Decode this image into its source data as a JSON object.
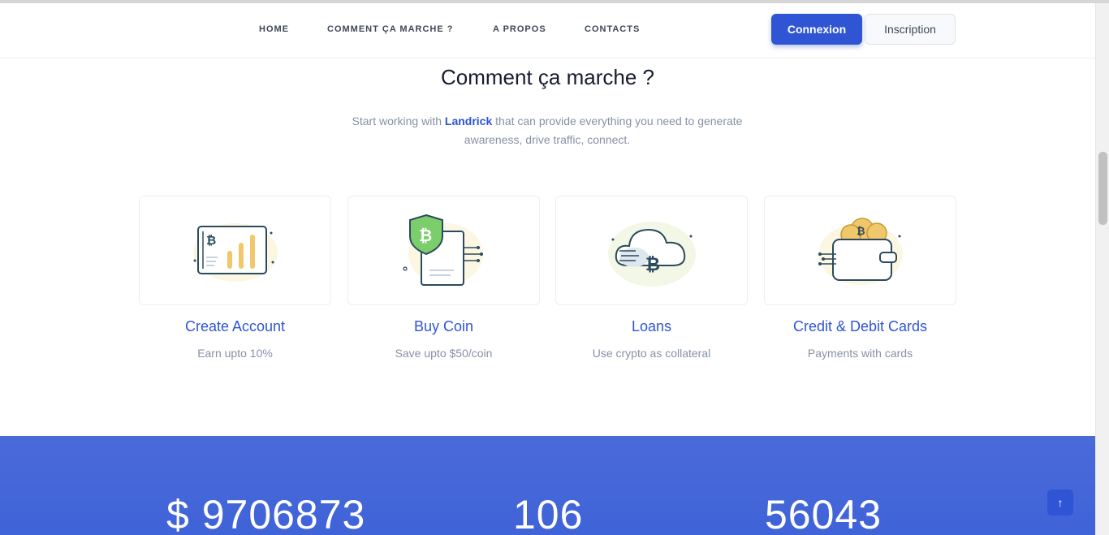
{
  "nav": {
    "items": [
      {
        "label": "HOME"
      },
      {
        "label": "COMMENT ÇA MARCHE ?"
      },
      {
        "label": "A PROPOS"
      },
      {
        "label": "CONTACTS"
      }
    ],
    "login_label": "Connexion",
    "signup_label": "Inscription"
  },
  "section": {
    "title": "Comment ça marche ?",
    "lead_prefix": "Start working with ",
    "lead_brand": "Landrick",
    "lead_suffix": " that can provide everything you need to generate awareness, drive traffic, connect."
  },
  "features": [
    {
      "title": "Create Account",
      "desc": "Earn upto 10%",
      "icon": "bitcoin-chart-icon"
    },
    {
      "title": "Buy Coin",
      "desc": "Save upto $50/coin",
      "icon": "bitcoin-shield-icon"
    },
    {
      "title": "Loans",
      "desc": "Use crypto as collateral",
      "icon": "bitcoin-cloud-icon"
    },
    {
      "title": "Credit & Debit Cards",
      "desc": "Payments with cards",
      "icon": "bitcoin-wallet-icon"
    }
  ],
  "stats": [
    {
      "value": "$ 9706873"
    },
    {
      "value": "106"
    },
    {
      "value": "56043"
    }
  ],
  "back_to_top": "↑",
  "colors": {
    "primary": "#2f55d4",
    "text": "#3c4858",
    "muted": "#8492a6",
    "bitcoin_yellow": "#f0c76a",
    "shield_green": "#7ccd6b"
  }
}
